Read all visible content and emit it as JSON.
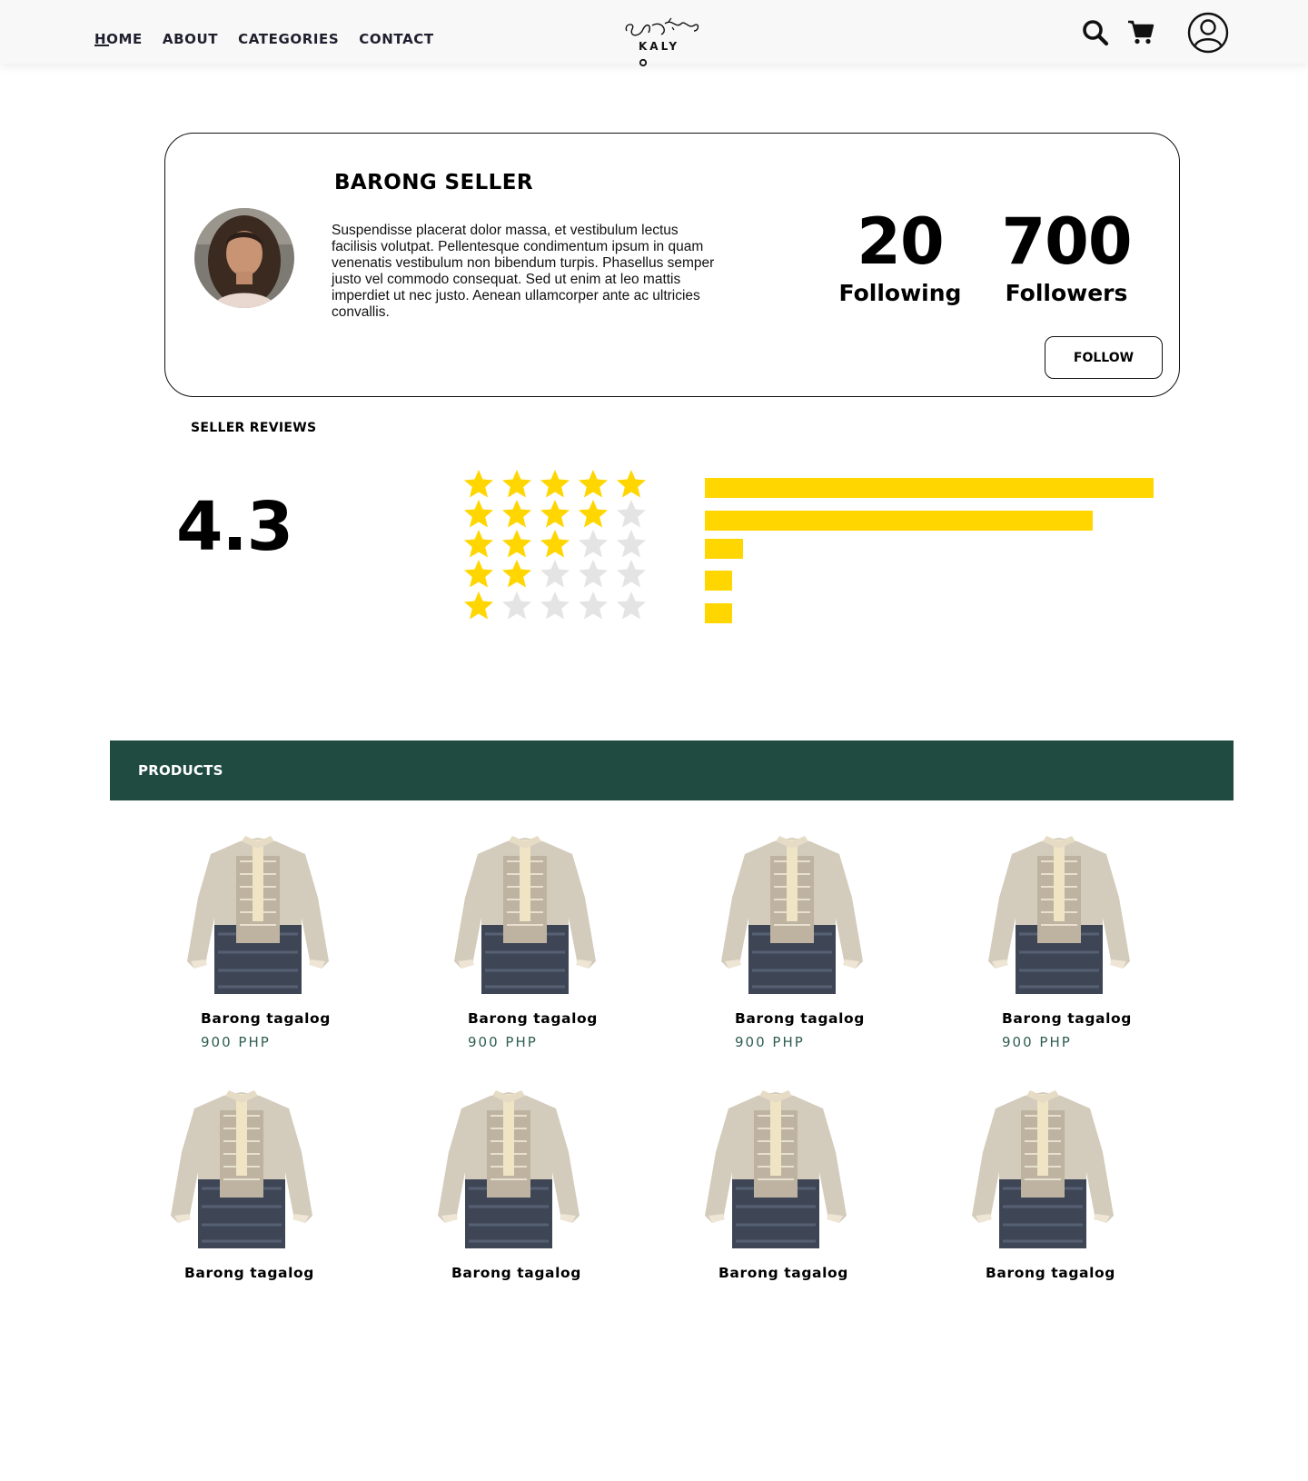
{
  "nav": {
    "items": [
      {
        "label": "HOME",
        "active": true
      },
      {
        "label": "ABOUT"
      },
      {
        "label": "CATEGORIES"
      },
      {
        "label": "CONTACT"
      }
    ]
  },
  "logo": {
    "text": "KALY"
  },
  "header_icons": [
    "search-icon",
    "cart-icon",
    "user-icon"
  ],
  "seller": {
    "name": "BARONG SELLER",
    "bio": "Suspendisse placerat dolor massa, et vestibulum lectus facilisis volutpat. Pellentesque condimentum ipsum in quam venenatis vestibulum non bibendum turpis. Phasellus semper justo vel commodo consequat. Sed ut enim at leo mattis imperdiet ut nec justo. Aenean ullamcorper ante ac ultricies convallis.",
    "following": {
      "count": "20",
      "label": "Following"
    },
    "followers": {
      "count": "700",
      "label": "Followers"
    },
    "follow_button": "FOLLOW"
  },
  "reviews": {
    "title": "SELLER REVIEWS",
    "average": "4.3",
    "distribution": [
      {
        "stars": 5,
        "share": 1.0
      },
      {
        "stars": 4,
        "share": 0.865
      },
      {
        "stars": 3,
        "share": 0.085
      },
      {
        "stars": 2,
        "share": 0.06
      },
      {
        "stars": 1,
        "share": 0.06
      }
    ],
    "colors": {
      "star_filled": "#ffd600",
      "star_empty": "#e4e4e4",
      "bar": "#ffd600"
    }
  },
  "products": {
    "title": "PRODUCTS",
    "band_color": "#1f4b40",
    "items": [
      {
        "name": "Barong tagalog",
        "price": "900 PHP"
      },
      {
        "name": "Barong tagalog",
        "price": "900 PHP"
      },
      {
        "name": "Barong tagalog",
        "price": "900 PHP"
      },
      {
        "name": "Barong tagalog",
        "price": "900 PHP"
      },
      {
        "name": "Barong tagalog",
        "price": ""
      },
      {
        "name": "Barong tagalog",
        "price": ""
      },
      {
        "name": "Barong tagalog",
        "price": ""
      },
      {
        "name": "Barong tagalog",
        "price": ""
      }
    ]
  }
}
